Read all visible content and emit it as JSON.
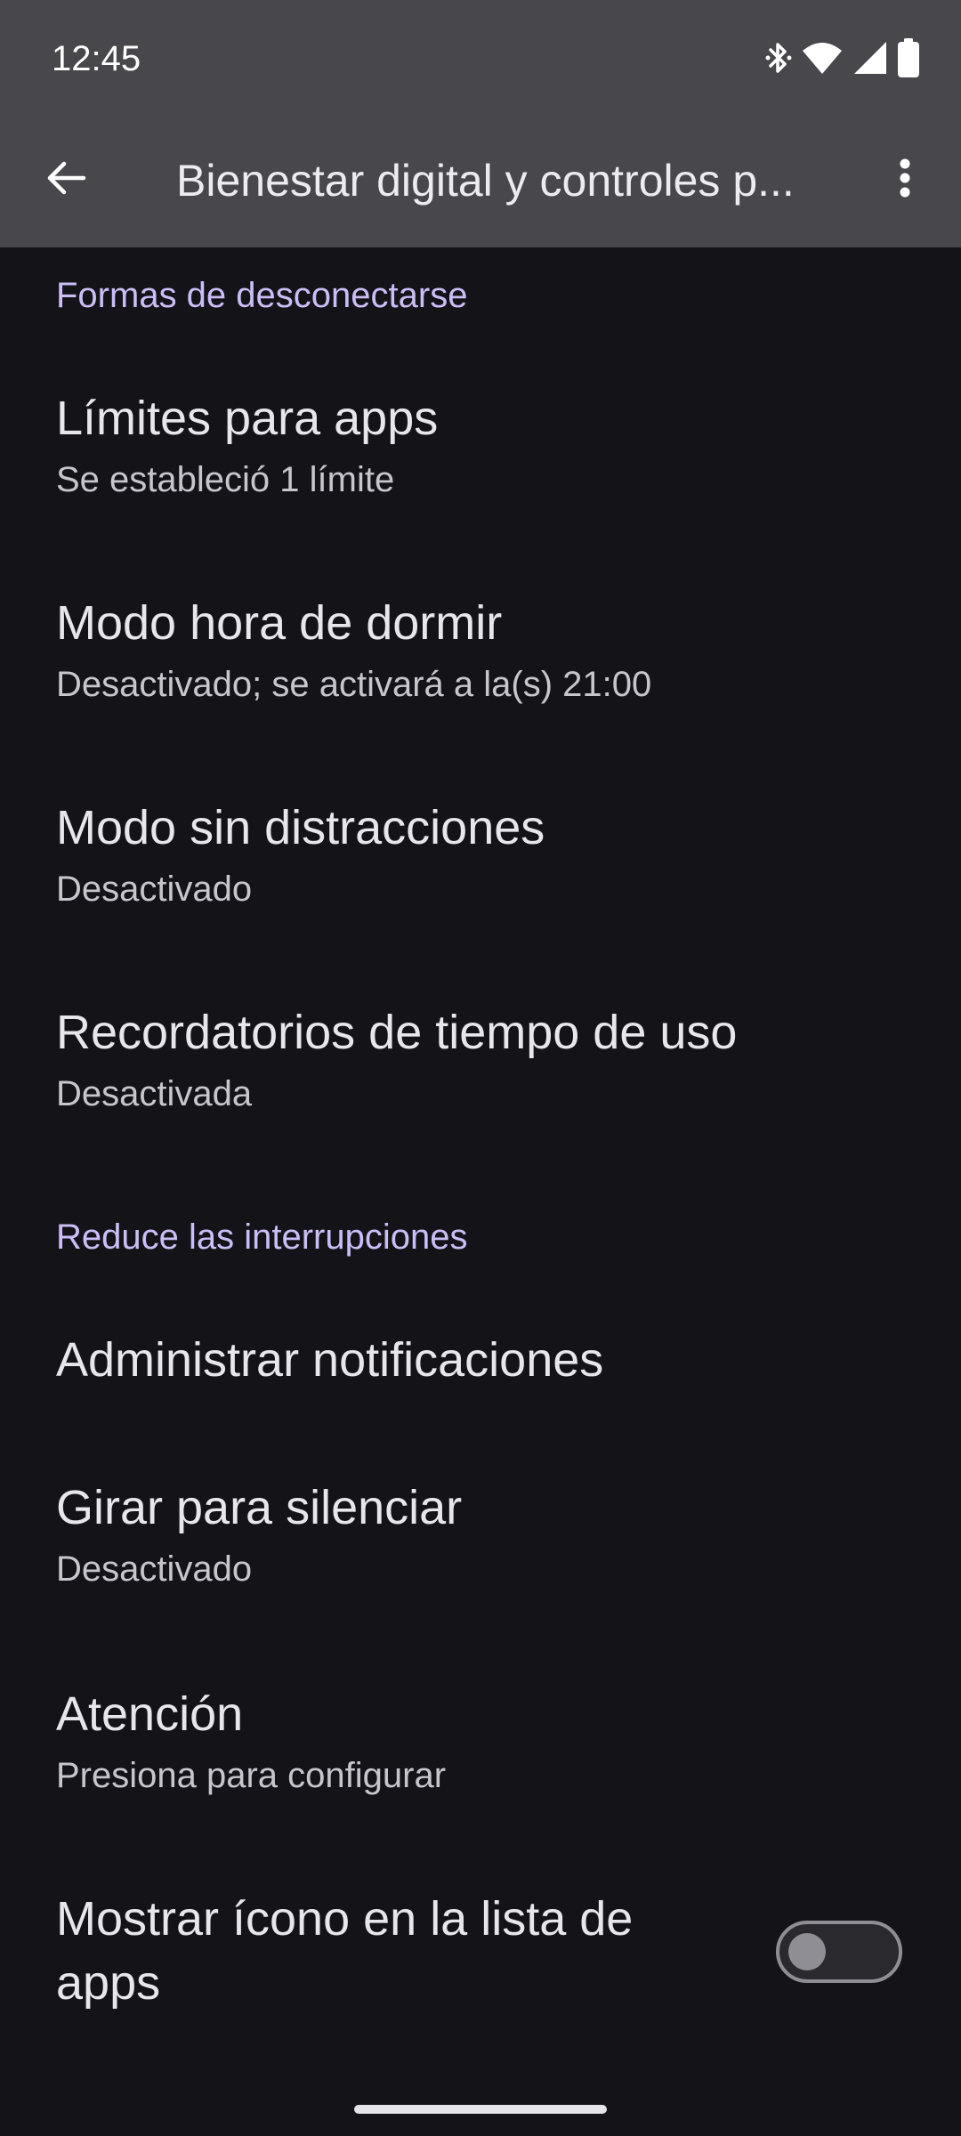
{
  "status_bar": {
    "time": "12:45",
    "icons": [
      "bluetooth-icon",
      "wifi-icon",
      "signal-icon",
      "battery-icon"
    ]
  },
  "app_bar": {
    "title": "Bienestar digital y controles p...",
    "back_icon": "arrow-back-icon",
    "menu_icon": "more-vert-icon"
  },
  "sections": [
    {
      "header": "Formas de desconectarse",
      "items": [
        {
          "title": "Límites para apps",
          "subtitle": "Se estableció 1 límite"
        },
        {
          "title": "Modo hora de dormir",
          "subtitle": "Desactivado; se activará a la(s) 21:00"
        },
        {
          "title": "Modo sin distracciones",
          "subtitle": "Desactivado"
        },
        {
          "title": "Recordatorios de tiempo de uso",
          "subtitle": "Desactivada"
        }
      ]
    },
    {
      "header": "Reduce las interrupciones",
      "items": [
        {
          "title": "Administrar notificaciones"
        },
        {
          "title": "Girar para silenciar",
          "subtitle": "Desactivado"
        },
        {
          "title": "Atención",
          "subtitle": "Presiona para configurar"
        },
        {
          "title_line1": "Mostrar ícono en la lista de",
          "title_line2": "apps",
          "toggle_on": false
        }
      ]
    }
  ],
  "colors": {
    "background": "#141318",
    "app_bar": "#48474c",
    "section_header": "#cbbef7",
    "title_text": "#e7e6eb",
    "subtitle_text": "#c7c6cc"
  }
}
